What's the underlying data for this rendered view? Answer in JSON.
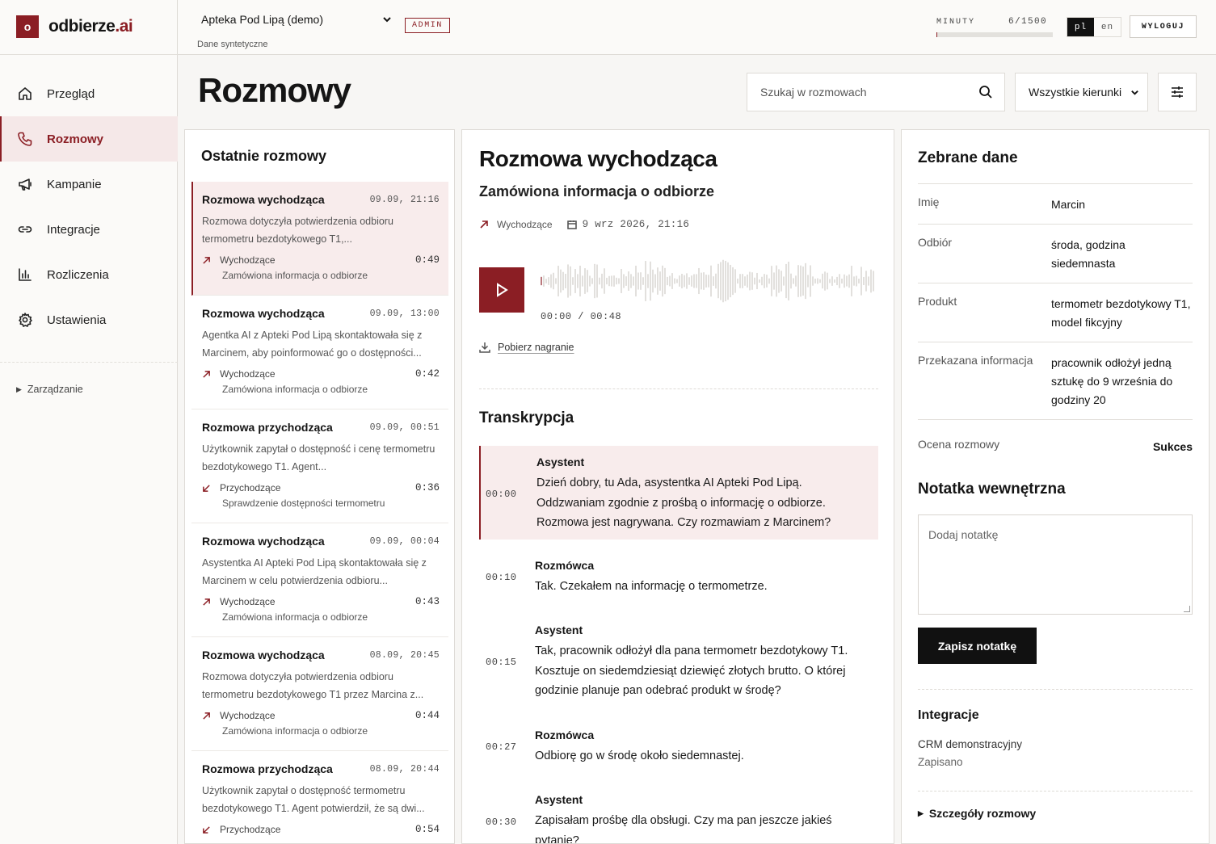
{
  "app": {
    "logo_mark": "o",
    "logo_name": "odbierze",
    "logo_suffix": ".ai"
  },
  "sidebar": {
    "items": [
      {
        "label": "Przegląd",
        "icon": "home-icon"
      },
      {
        "label": "Rozmowy",
        "icon": "phone-icon",
        "active": true
      },
      {
        "label": "Kampanie",
        "icon": "megaphone-icon"
      },
      {
        "label": "Integracje",
        "icon": "link-icon"
      },
      {
        "label": "Rozliczenia",
        "icon": "bar-chart-icon"
      },
      {
        "label": "Ustawienia",
        "icon": "gear-icon"
      }
    ],
    "management": "Zarządzanie"
  },
  "topbar": {
    "pharmacy": "Apteka Pod Lipą (demo)",
    "synthetic": "Dane syntetyczne",
    "role_badge": "ADMIN",
    "minutes_label": "MINUTY",
    "minutes_value": "6/1500",
    "minutes_used_fraction": 0.004,
    "lang_active": "pl",
    "lang_other": "en",
    "logout": "WYLOGUJ"
  },
  "page": {
    "title": "Rozmowy",
    "search_placeholder": "Szukaj w rozmowach",
    "direction_filter": "Wszystkie kierunki"
  },
  "list": {
    "title": "Ostatnie rozmowy",
    "calls": [
      {
        "title": "Rozmowa wychodząca",
        "date": "09.09, 21:16",
        "summary": "Rozmowa dotyczyła potwierdzenia odbioru termometru bezdotykowego T1,...",
        "direction": "Wychodzące",
        "duration": "0:49",
        "topic": "Zamówiona informacja o odbiorze",
        "outgoing": true
      },
      {
        "title": "Rozmowa wychodząca",
        "date": "09.09, 13:00",
        "summary": "Agentka AI z Apteki Pod Lipą skontaktowała się z Marcinem, aby poinformować go o dostępności...",
        "direction": "Wychodzące",
        "duration": "0:42",
        "topic": "Zamówiona informacja o odbiorze",
        "outgoing": true
      },
      {
        "title": "Rozmowa przychodząca",
        "date": "09.09, 00:51",
        "summary": "Użytkownik zapytał o dostępność i cenę termometru bezdotykowego T1. Agent...",
        "direction": "Przychodzące",
        "duration": "0:36",
        "topic": "Sprawdzenie dostępności termometru",
        "outgoing": false
      },
      {
        "title": "Rozmowa wychodząca",
        "date": "09.09, 00:04",
        "summary": "Asystentka AI Apteki Pod Lipą skontaktowała się z Marcinem w celu potwierdzenia odbioru...",
        "direction": "Wychodzące",
        "duration": "0:43",
        "topic": "Zamówiona informacja o odbiorze",
        "outgoing": true
      },
      {
        "title": "Rozmowa wychodząca",
        "date": "08.09, 20:45",
        "summary": "Rozmowa dotyczyła potwierdzenia odbioru termometru bezdotykowego T1 przez Marcina z...",
        "direction": "Wychodzące",
        "duration": "0:44",
        "topic": "Zamówiona informacja o odbiorze",
        "outgoing": true
      },
      {
        "title": "Rozmowa przychodząca",
        "date": "08.09, 20:44",
        "summary": "Użytkownik zapytał o dostępność termometru bezdotykowego T1. Agent potwierdził, że są dwi...",
        "direction": "Przychodzące",
        "duration": "0:54",
        "topic": "",
        "outgoing": false
      }
    ]
  },
  "detail": {
    "title": "Rozmowa wychodząca",
    "subtitle": "Zamówiona informacja o odbiorze",
    "direction": "Wychodzące",
    "datetime": "9 wrz 2026, 21:16",
    "time_display": "00:00 / 00:48",
    "download": "Pobierz nagranie",
    "transcript_title": "Transkrypcja",
    "transcript": [
      {
        "time": "00:00",
        "speaker": "Asystent",
        "text": "Dzień dobry, tu Ada, asystentka AI Apteki Pod Lipą. Oddzwaniam zgodnie z prośbą o informację o odbiorze. Rozmowa jest nagrywana. Czy rozmawiam z Marcinem?",
        "highlight": true
      },
      {
        "time": "00:10",
        "speaker": "Rozmówca",
        "text": "Tak. Czekałem na informację o termometrze."
      },
      {
        "time": "00:15",
        "speaker": "Asystent",
        "text": "Tak, pracownik odłożył dla pana termometr bezdotykowy T1. Kosztuje on siedemdziesiąt dziewięć złotych brutto. O której godzinie planuje pan odebrać produkt w środę?"
      },
      {
        "time": "00:27",
        "speaker": "Rozmówca",
        "text": "Odbiorę go w środę około siedemnastej."
      },
      {
        "time": "00:30",
        "speaker": "Asystent",
        "text": "Zapisałam prośbę dla obsługi. Czy ma pan jeszcze jakieś pytanie?"
      }
    ]
  },
  "data_panel": {
    "title": "Zebrane dane",
    "fields": [
      {
        "key": "Imię",
        "value": "Marcin"
      },
      {
        "key": "Odbiór",
        "value": "środa, godzina siedemnasta"
      },
      {
        "key": "Produkt",
        "value": "termometr bezdotykowy T1, model fikcyjny"
      },
      {
        "key": "Przekazana informacja",
        "value": "pracownik odłożył jedną sztukę do 9 września do godziny 20"
      },
      {
        "key": "Ocena rozmowy",
        "value": "Sukces"
      }
    ],
    "note_title": "Notatka wewnętrzna",
    "note_placeholder": "Dodaj notatkę",
    "save_note": "Zapisz notatkę",
    "integrations_title": "Integracje",
    "crm_name": "CRM demonstracyjny",
    "crm_status": "Zapisano",
    "details": "Szczegóły rozmowy"
  },
  "colors": {
    "accent": "#8b1e24",
    "accent_light": "#f8ecec",
    "dark": "#111111"
  }
}
